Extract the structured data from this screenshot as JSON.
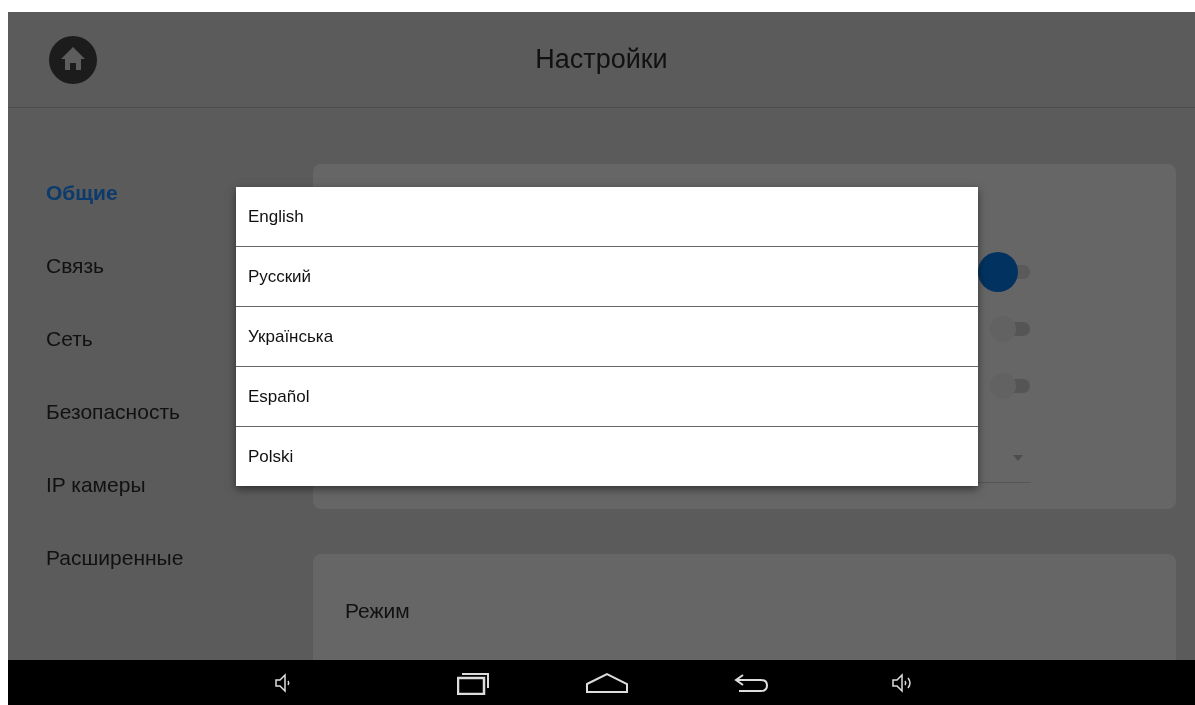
{
  "header": {
    "title": "Настройки"
  },
  "sidebar": {
    "items": [
      {
        "label": "Общие",
        "selected": true
      },
      {
        "label": "Связь",
        "selected": false
      },
      {
        "label": "Сеть",
        "selected": false
      },
      {
        "label": "Безопасность",
        "selected": false
      },
      {
        "label": "IP камеры",
        "selected": false
      },
      {
        "label": "Расширенные",
        "selected": false
      }
    ]
  },
  "general_card": {
    "toggles": [
      {
        "on": true
      },
      {
        "on": false
      },
      {
        "on": false
      }
    ]
  },
  "mode_card": {
    "title": "Режим"
  },
  "language_menu": {
    "options": [
      {
        "label": "English"
      },
      {
        "label": "Русский"
      },
      {
        "label": "Українська"
      },
      {
        "label": "Español"
      },
      {
        "label": "Polski"
      }
    ]
  }
}
